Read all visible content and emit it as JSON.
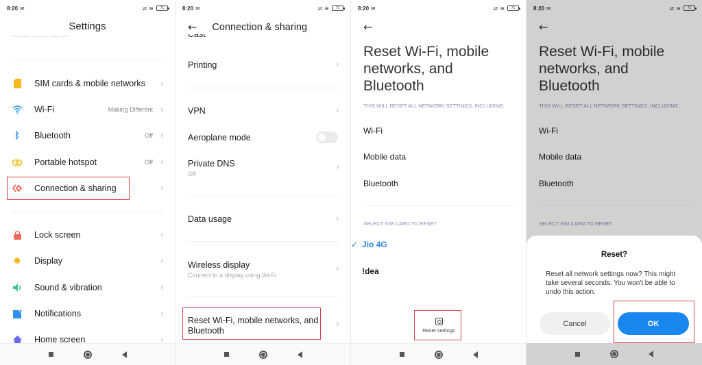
{
  "status_bar": {
    "time": "8:20",
    "battery": "71"
  },
  "colors": {
    "accent": "#1a87f0",
    "highlight": "#d5404a",
    "selected": "#2f84e0"
  },
  "panel1": {
    "title": "Settings",
    "items": [
      {
        "label": "SIM cards & mobile networks",
        "value": "",
        "icon": "sim-card-icon"
      },
      {
        "label": "Wi-Fi",
        "value": "Making Different",
        "icon": "wifi-icon"
      },
      {
        "label": "Bluetooth",
        "value": "Off",
        "icon": "bluetooth-icon"
      },
      {
        "label": "Portable hotspot",
        "value": "Off",
        "icon": "hotspot-icon"
      },
      {
        "label": "Connection & sharing",
        "value": "",
        "icon": "connection-sharing-icon"
      },
      {
        "label": "Lock screen",
        "value": "",
        "icon": "lock-icon"
      },
      {
        "label": "Display",
        "value": "",
        "icon": "sun-icon"
      },
      {
        "label": "Sound & vibration",
        "value": "",
        "icon": "speaker-icon"
      },
      {
        "label": "Notifications",
        "value": "",
        "icon": "notification-icon"
      },
      {
        "label": "Home screen",
        "value": "",
        "icon": "home-icon"
      }
    ]
  },
  "panel2": {
    "title": "Connection & sharing",
    "cut_item": "Cast",
    "items": [
      {
        "label": "Printing",
        "sub": ""
      },
      {
        "label": "VPN",
        "sub": ""
      },
      {
        "label": "Aeroplane mode",
        "sub": "",
        "toggle": false
      },
      {
        "label": "Private DNS",
        "sub": "Off"
      },
      {
        "label": "Data usage",
        "sub": ""
      },
      {
        "label": "Wireless display",
        "sub": "Connect to a display using Wi-Fi"
      },
      {
        "label": "Reset Wi-Fi, mobile networks, and Bluetooth",
        "sub": ""
      }
    ]
  },
  "panel3": {
    "title": "Reset Wi-Fi, mobile networks, and Bluetooth",
    "caption": "THIS WILL RESET ALL NETWORK SETTINGS, INCLUDING:",
    "items": [
      "Wi-Fi",
      "Mobile data",
      "Bluetooth"
    ],
    "sim_caption": "SELECT SIM CARD TO RESET",
    "sims": [
      {
        "label": "Jio 4G",
        "selected": true
      },
      {
        "label": "!dea",
        "selected": false
      }
    ],
    "reset_button": "Reset settings"
  },
  "panel4": {
    "title": "Reset Wi-Fi, mobile networks, and Bluetooth",
    "caption": "THIS WILL RESET ALL NETWORK SETTINGS, INCLUDING:",
    "items": [
      "Wi-Fi",
      "Mobile data",
      "Bluetooth"
    ],
    "sim_caption": "SELECT SIM CARD TO RESET",
    "dialog": {
      "title": "Reset?",
      "message": "Reset all network settings now? This might take several seconds. You won't be able to undo this action.",
      "cancel": "Cancel",
      "ok": "OK"
    }
  }
}
